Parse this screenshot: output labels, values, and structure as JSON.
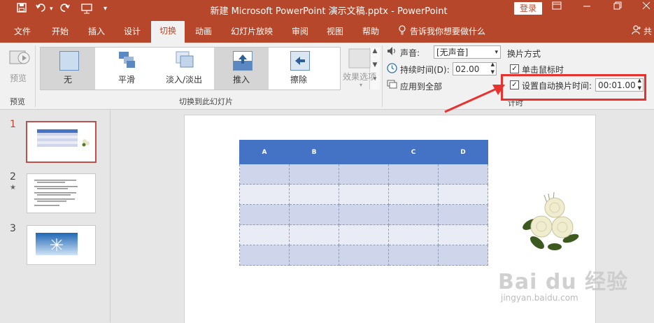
{
  "titlebar": {
    "title": "新建 Microsoft PowerPoint 演示文稿.pptx  -  PowerPoint",
    "login": "登录",
    "quick_save_icon": "save-icon",
    "quick_undo_icon": "undo-icon",
    "quick_redo_icon": "redo-icon",
    "quick_present_icon": "present-icon"
  },
  "tabs": [
    "文件",
    "开始",
    "插入",
    "设计",
    "切换",
    "动画",
    "幻灯片放映",
    "审阅",
    "视图",
    "帮助"
  ],
  "active_tab": "切换",
  "tell_me": "告诉我你想要做什么",
  "share": "共",
  "ribbon": {
    "preview_label": "预览",
    "preview_group": "预览",
    "transitions": [
      "无",
      "平滑",
      "淡入/淡出",
      "推入",
      "擦除"
    ],
    "transitions_group": "切换到此幻灯片",
    "effect_options": "效果选项",
    "sound_label": "声音:",
    "sound_value": "[无声音]",
    "duration_label": "持续时间(D):",
    "duration_value": "02.00",
    "apply_all": "应用到全部",
    "advance_heading": "换片方式",
    "on_click": "单击鼠标时",
    "auto_advance": "设置自动换片时间:",
    "auto_advance_value": "00:01.00",
    "timing_group": "计时"
  },
  "slides": [
    "1",
    "2",
    "3"
  ],
  "slide_table": {
    "headers": [
      "A",
      "B",
      "",
      "C",
      "D"
    ],
    "rows": 5
  },
  "watermark": {
    "main": "Bai du 经验",
    "sub": "jingyan.baidu.com"
  },
  "colors": {
    "accent": "#b7472a",
    "highlight": "#e8322f",
    "table_header": "#4472c4"
  }
}
